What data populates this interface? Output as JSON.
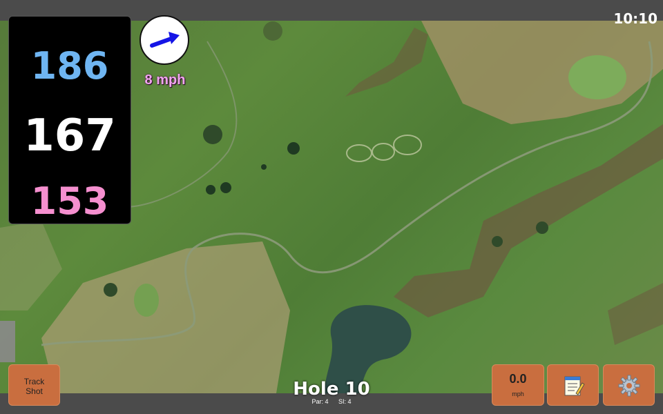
{
  "status_bar": {
    "time": "10:10"
  },
  "distances": {
    "back": "186",
    "center": "167",
    "front": "153"
  },
  "wind": {
    "speed_label": "8 mph",
    "arrow_icon": "arrow-right-icon"
  },
  "hole": {
    "title": "Hole 10",
    "par_label": "Par: 4",
    "si_label": "SI: 4"
  },
  "buttons": {
    "track_shot_line1": "Track",
    "track_shot_line2": "Shot",
    "speed_value": "0.0",
    "speed_unit": "mph",
    "notes_icon": "notepad-icon",
    "settings_icon": "gear-icon"
  },
  "colors": {
    "back_distance": "#6fb5f2",
    "center_distance": "#ffffff",
    "front_distance": "#f58fcf",
    "button": "#c96e3f",
    "wind_text": "#f0a6ee"
  }
}
